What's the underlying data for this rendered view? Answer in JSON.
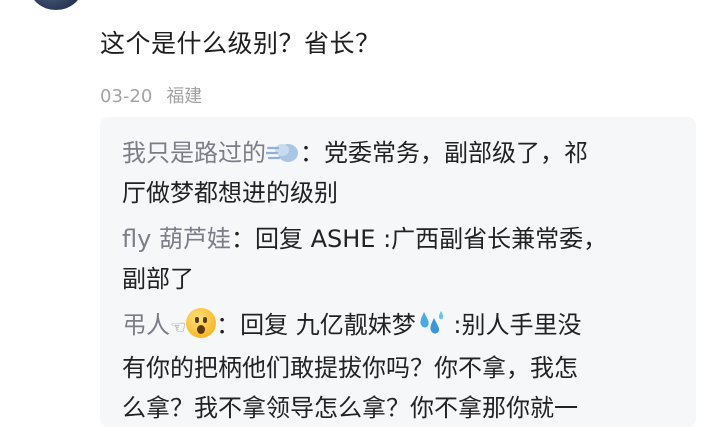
{
  "comment": {
    "text": "这个是什么级别？省长？",
    "date": "03-20",
    "location": "福建"
  },
  "replies": [
    {
      "user": "我只是路过的",
      "user_icon": "dash-emoji",
      "line1": "：党委常务，副部级了，祁",
      "line2": "厅做梦都想进的级别"
    },
    {
      "user": "fly 葫芦娃",
      "line1": "：回复 ASHE :广西副省长兼常委，",
      "line2": "副部了"
    },
    {
      "user": "弔人",
      "user_suffix": "☜",
      "user_icon": "astonished-face-emoji",
      "line1a": "：回复 九亿靓妹梦",
      "line1_icon": "sweat-droplets-emoji",
      "line1b": " :别人手里没",
      "line2": "有你的把柄他们敢提拔你吗？你不拿，我怎",
      "line3": "么拿？我不拿领导怎么拿？你不拿那你就一"
    }
  ],
  "colors": {
    "username": "#7b7e86",
    "meta": "#a3a3a3",
    "reply_bg": "#f6f7f9"
  }
}
